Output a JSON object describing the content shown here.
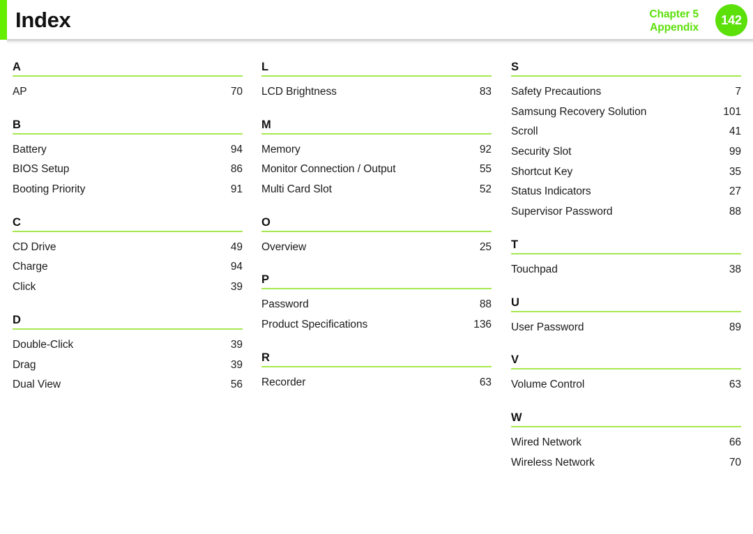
{
  "header": {
    "title": "Index",
    "chapter_line1": "Chapter 5",
    "chapter_line2": "Appendix",
    "page_number": "142",
    "accent_color": "#66ee00",
    "chapter_text_color": "#5be00a",
    "badge_color": "#5be00a",
    "rule_color": "#a6e84f"
  },
  "index": {
    "columns": [
      {
        "groups": [
          {
            "letter": "A",
            "entries": [
              {
                "label": "AP",
                "page": "70"
              }
            ]
          },
          {
            "letter": "B",
            "entries": [
              {
                "label": "Battery",
                "page": "94"
              },
              {
                "label": "BIOS Setup",
                "page": "86"
              },
              {
                "label": "Booting Priority",
                "page": "91"
              }
            ]
          },
          {
            "letter": "C",
            "entries": [
              {
                "label": "CD Drive",
                "page": "49"
              },
              {
                "label": "Charge",
                "page": "94"
              },
              {
                "label": "Click",
                "page": "39"
              }
            ]
          },
          {
            "letter": "D",
            "entries": [
              {
                "label": "Double-Click",
                "page": "39"
              },
              {
                "label": "Drag",
                "page": "39"
              },
              {
                "label": "Dual View",
                "page": "56"
              }
            ]
          }
        ]
      },
      {
        "groups": [
          {
            "letter": "L",
            "entries": [
              {
                "label": "LCD Brightness",
                "page": "83"
              }
            ]
          },
          {
            "letter": "M",
            "entries": [
              {
                "label": "Memory",
                "page": "92"
              },
              {
                "label": "Monitor Connection / Output",
                "page": "55"
              },
              {
                "label": "Multi Card Slot",
                "page": "52"
              }
            ]
          },
          {
            "letter": "O",
            "entries": [
              {
                "label": "Overview",
                "page": "25"
              }
            ]
          },
          {
            "letter": "P",
            "entries": [
              {
                "label": "Password",
                "page": "88"
              },
              {
                "label": "Product Specifications",
                "page": "136"
              }
            ]
          },
          {
            "letter": "R",
            "entries": [
              {
                "label": "Recorder",
                "page": "63"
              }
            ]
          }
        ]
      },
      {
        "groups": [
          {
            "letter": "S",
            "entries": [
              {
                "label": "Safety Precautions",
                "page": "7"
              },
              {
                "label": "Samsung Recovery Solution",
                "page": "101"
              },
              {
                "label": "Scroll",
                "page": "41"
              },
              {
                "label": "Security Slot",
                "page": "99"
              },
              {
                "label": "Shortcut Key",
                "page": "35"
              },
              {
                "label": "Status Indicators",
                "page": "27"
              },
              {
                "label": "Supervisor Password",
                "page": "88"
              }
            ]
          },
          {
            "letter": "T",
            "entries": [
              {
                "label": "Touchpad",
                "page": "38"
              }
            ]
          },
          {
            "letter": "U",
            "entries": [
              {
                "label": "User Password",
                "page": "89"
              }
            ]
          },
          {
            "letter": "V",
            "entries": [
              {
                "label": "Volume Control",
                "page": "63"
              }
            ]
          },
          {
            "letter": "W",
            "entries": [
              {
                "label": "Wired Network",
                "page": "66"
              },
              {
                "label": "Wireless Network",
                "page": "70"
              }
            ]
          }
        ]
      }
    ]
  }
}
